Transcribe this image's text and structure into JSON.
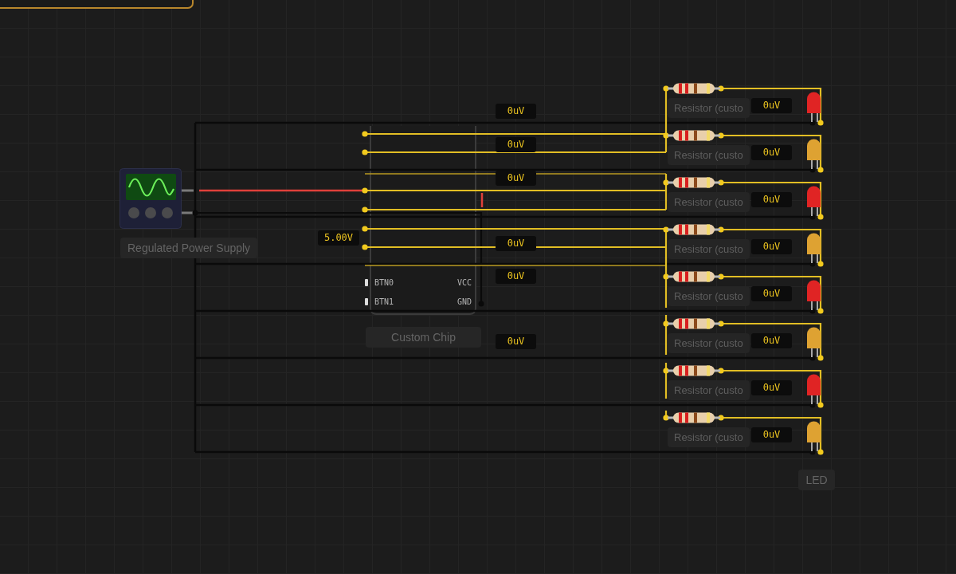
{
  "power_supply": {
    "label": "Regulated Power Supply"
  },
  "supply_probe": {
    "reading": "5.00V"
  },
  "chip": {
    "label": "Custom Chip",
    "pins": [
      {
        "left": "BTN0",
        "right": "VCC"
      },
      {
        "left": "BTN1",
        "right": "GND"
      }
    ]
  },
  "probes": [
    {
      "reading": "0uV"
    },
    {
      "reading": "0uV"
    },
    {
      "reading": "0uV"
    },
    {
      "reading": "0uV"
    },
    {
      "reading": "0uV"
    },
    {
      "reading": "0uV"
    }
  ],
  "stages": [
    {
      "resistor_label": "Resistor (custo",
      "reading": "0uV",
      "color": "#e02424"
    },
    {
      "resistor_label": "Resistor (custo",
      "reading": "0uV",
      "color": "#dea232"
    },
    {
      "resistor_label": "Resistor (custo",
      "reading": "0uV",
      "color": "#e02424"
    },
    {
      "resistor_label": "Resistor (custo",
      "reading": "0uV",
      "color": "#dea232"
    },
    {
      "resistor_label": "Resistor (custo",
      "reading": "0uV",
      "color": "#e02424"
    },
    {
      "resistor_label": "Resistor (custo",
      "reading": "0uV",
      "color": "#dea232"
    },
    {
      "resistor_label": "Resistor (custo",
      "reading": "0uV",
      "color": "#e02424"
    },
    {
      "resistor_label": "Resistor (custo",
      "reading": "0uV",
      "color": "#dea232"
    }
  ],
  "led_label": "LED"
}
